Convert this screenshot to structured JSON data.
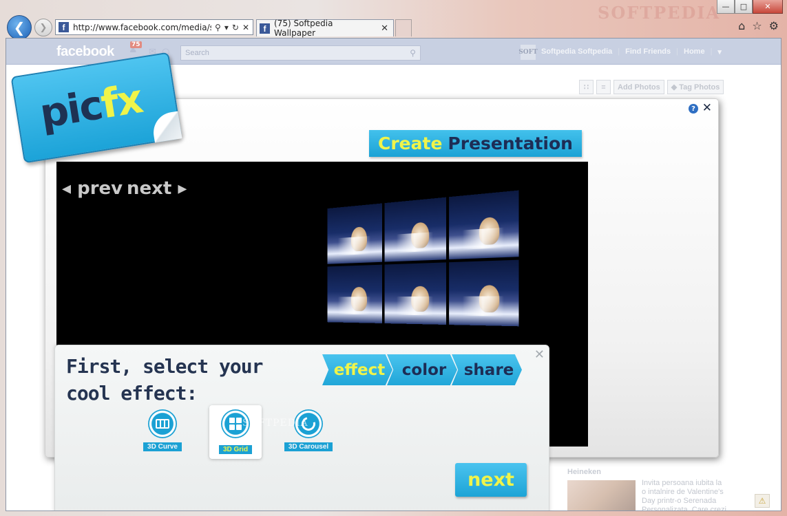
{
  "browser": {
    "watermark": "SOFTPEDIA",
    "address": "http://www.facebook.com/media/se",
    "tab_title": "(75) Softpedia Wallpaper",
    "favicon": "f"
  },
  "facebook": {
    "logo": "facebook",
    "notifications": "75",
    "search_placeholder": "Search",
    "profile_thumb": "SOFT",
    "profile_name": "Softpedia Softpedia",
    "find_friends": "Find Friends",
    "home": "Home",
    "add_photos": "Add Photos",
    "tag_photos": "Tag Photos",
    "sidebar_heading": "Heineken",
    "ad_text": "Invita persoana iubita la o intalnire de Valentine's Day printr-o Serenada Personalizata. Care crezi"
  },
  "app": {
    "logo_pic": "pic",
    "logo_fx": "fx",
    "banner_create": "Create",
    "banner_presentation": "Presentation",
    "prev": "prev",
    "next_nav": "next",
    "panel_title": "First, select your cool effect:",
    "steps": [
      "effect",
      "color",
      "share"
    ],
    "effects": [
      "3D Curve",
      "3D Grid",
      "3D Carousel"
    ],
    "next_button": "next",
    "watermark": "SOFTPEDIA"
  }
}
